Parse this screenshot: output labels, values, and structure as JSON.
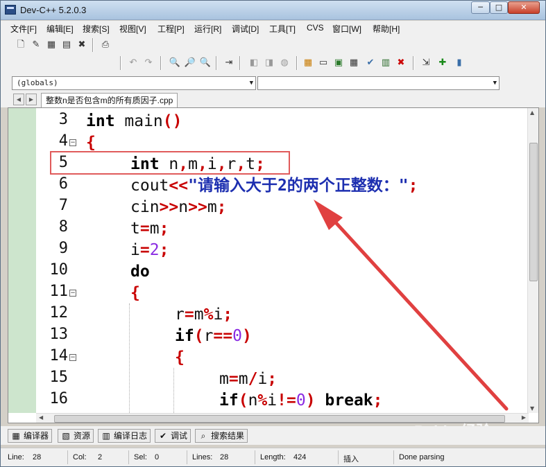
{
  "window": {
    "title": "Dev-C++ 5.2.0.3",
    "min_glyph": "─",
    "max_glyph": "□",
    "close_glyph": "✕"
  },
  "menu": [
    "文件[F]",
    "编辑[E]",
    "搜索[S]",
    "视图[V]",
    "工程[P]",
    "运行[R]",
    "调试[D]",
    "工具[T]",
    "CVS",
    "窗口[W]",
    "帮助[H]"
  ],
  "scope": {
    "globals": "(globals)",
    "second": ""
  },
  "tabs": {
    "file": "整数n是否包含m的所有质因子.cpp",
    "prev": "◀",
    "next": "▶"
  },
  "editor": {
    "line_numbers": [
      "3",
      "4",
      "5",
      "6",
      "7",
      "8",
      "9",
      "10",
      "11",
      "12",
      "13",
      "14",
      "15",
      "16"
    ],
    "fold_marks": [
      "−",
      "−",
      "−"
    ],
    "lines": {
      "l3a": "int",
      "l3b": " main",
      "l3c": "()",
      "l4": "{",
      "l5a": "int",
      "l5b": " n",
      "l5c": ",",
      "l5d": "m",
      "l5e": ",",
      "l5f": "i",
      "l5g": ",",
      "l5h": "r",
      "l5i": ",",
      "l5j": "t",
      "l5k": ";",
      "l6a": "cout",
      "l6b": "<<",
      "l6c": "\"请输入大于2的两个正整数：\"",
      "l6d": ";",
      "l7a": "cin",
      "l7b": ">>",
      "l7c": "n",
      "l7d": ">>",
      "l7e": "m",
      "l7f": ";",
      "l8a": "t",
      "l8b": "=",
      "l8c": "m",
      "l8d": ";",
      "l9a": "i",
      "l9b": "=",
      "l9c": "2",
      "l9d": ";",
      "l10": "do",
      "l11": "{",
      "l12a": "r",
      "l12b": "=",
      "l12c": "m",
      "l12d": "%",
      "l12e": "i",
      "l12f": ";",
      "l13a": "if",
      "l13b": "(",
      "l13c": "r",
      "l13d": "==",
      "l13e": "0",
      "l13f": ")",
      "l14": "{",
      "l15a": "m",
      "l15b": "=",
      "l15c": "m",
      "l15d": "/",
      "l15e": "i",
      "l15f": ";",
      "l16a": "if",
      "l16b": "(",
      "l16c": "n",
      "l16d": "%",
      "l16e": "i",
      "l16f": "!=",
      "l16g": "0",
      "l16h": ")",
      "l16i": " break",
      "l16j": ";"
    }
  },
  "bottom_tabs": [
    "编译器",
    "资源",
    "编译日志",
    "调试",
    "搜索结果"
  ],
  "status": {
    "line_label": "Line:",
    "line_value": "28",
    "col_label": "Col:",
    "col_value": "2",
    "sel_label": "Sel:",
    "sel_value": "0",
    "lines_label": "Lines:",
    "lines_value": "28",
    "length_label": "Length:",
    "length_value": "424",
    "mode": "插入",
    "message": "Done parsing"
  },
  "watermark": "Baidu 经验",
  "colors": {
    "arrow": "#e04040",
    "highlight_box": "#e05a5a",
    "gutter": "#cde5cd",
    "keyword_op": "#c80000",
    "string": "#1d2fb0"
  }
}
